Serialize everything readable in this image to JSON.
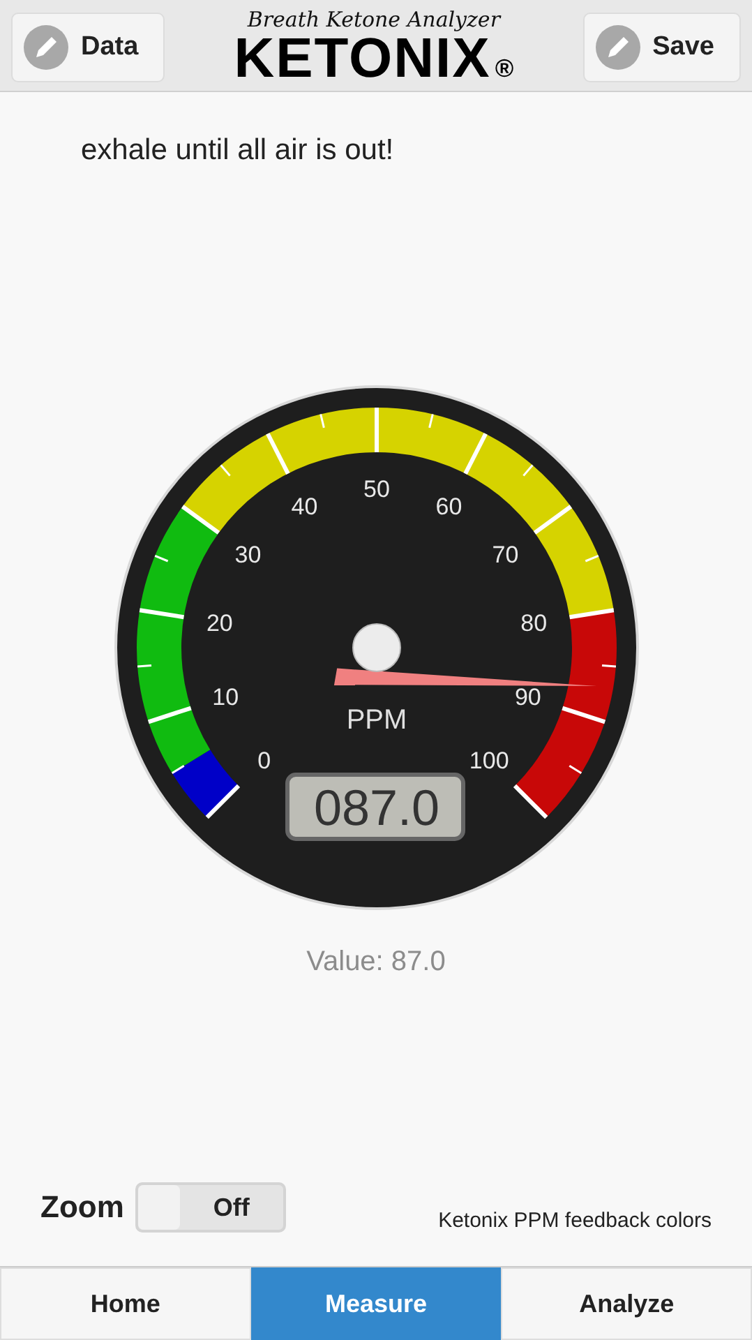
{
  "header": {
    "left_button": "Data",
    "right_button": "Save",
    "logo_tagline": "Breath Ketone Analyzer",
    "logo_name": "KETONIX",
    "logo_mark": "®"
  },
  "instruction": "exhale until all air is out!",
  "gauge": {
    "unit": "PPM",
    "scale_labels": [
      "0",
      "10",
      "20",
      "30",
      "40",
      "50",
      "60",
      "70",
      "80",
      "90",
      "100"
    ],
    "readout": "087.0"
  },
  "value_text": "Value: 87.0",
  "zoom": {
    "label": "Zoom",
    "state_text": "Off",
    "on": false
  },
  "legend": "Ketonix PPM feedback colors",
  "tabs": [
    {
      "label": "Home",
      "selected": false
    },
    {
      "label": "Measure",
      "selected": true
    },
    {
      "label": "Analyze",
      "selected": false
    }
  ]
}
